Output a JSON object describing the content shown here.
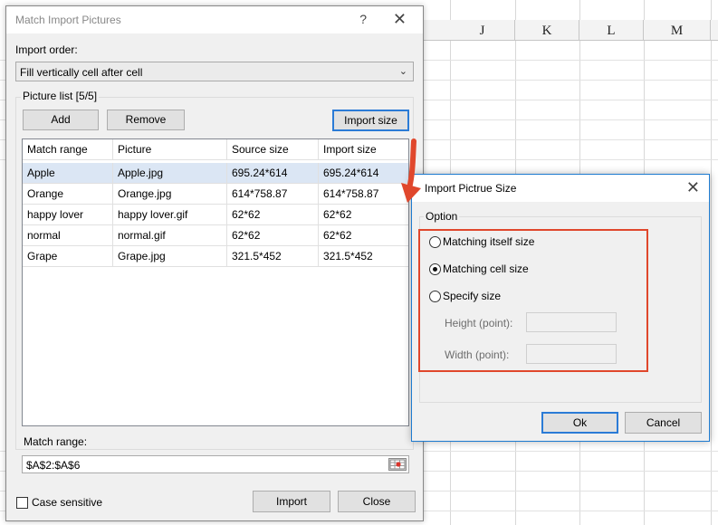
{
  "sheet": {
    "columns": [
      "J",
      "K",
      "L",
      "M"
    ]
  },
  "main_dialog": {
    "title": "Match Import Pictures",
    "help_glyph": "?",
    "close_glyph": "✕",
    "import_order_label": "Import order:",
    "import_order_value": "Fill vertically cell after cell",
    "picture_list_label": "Picture list [5/5]",
    "buttons": {
      "add": "Add",
      "remove": "Remove",
      "import_size": "Import size",
      "import": "Import",
      "close": "Close"
    },
    "table": {
      "headers": [
        "Match range",
        "Picture",
        "Source size",
        "Import size"
      ],
      "rows": [
        [
          "Apple",
          "Apple.jpg",
          "695.24*614",
          "695.24*614"
        ],
        [
          "Orange",
          "Orange.jpg",
          "614*758.87",
          "614*758.87"
        ],
        [
          "happy lover",
          "happy lover.gif",
          "62*62",
          "62*62"
        ],
        [
          "normal",
          "normal.gif",
          "62*62",
          "62*62"
        ],
        [
          "Grape",
          "Grape.jpg",
          "321.5*452",
          "321.5*452"
        ]
      ],
      "selected_row": 0
    },
    "match_range_label": "Match range:",
    "match_range_value": "$A$2:$A$6",
    "case_sensitive_label": "Case sensitive",
    "case_sensitive_checked": false
  },
  "size_dialog": {
    "title": "Import Pictrue Size",
    "close_glyph": "✕",
    "option_label": "Option",
    "options": {
      "matching_itself": "Matching itself size",
      "matching_cell": "Matching cell size",
      "specify": "Specify size"
    },
    "selected_option": "matching_cell",
    "height_label": "Height (point):",
    "width_label": "Width (point):",
    "height_value": "",
    "width_value": "",
    "ok": "Ok",
    "cancel": "Cancel"
  },
  "colors": {
    "highlight": "#e0472c",
    "selected_row": "#dbe6f4",
    "focus_border": "#2b7bd6"
  }
}
